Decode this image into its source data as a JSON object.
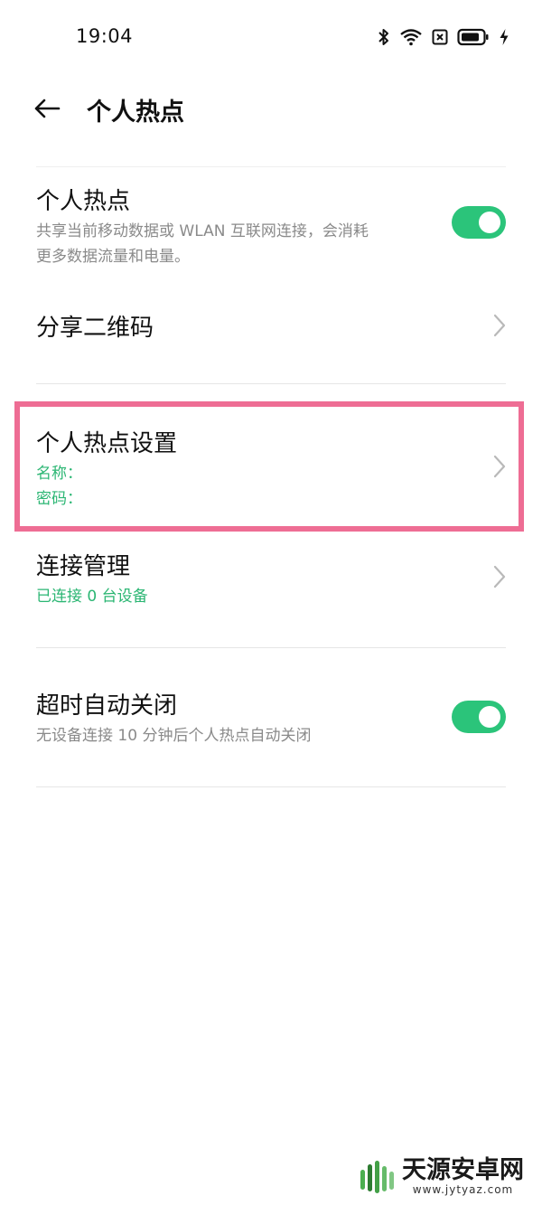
{
  "status_bar": {
    "time": "19:04"
  },
  "header": {
    "title": "个人热点"
  },
  "items": [
    {
      "title": "个人热点",
      "subtitle_line1": "共享当前移动数据或 WLAN 互联网连接，会消耗",
      "subtitle_line2": "更多数据流量和电量。",
      "toggle_on": true
    },
    {
      "title": "分享二维码"
    },
    {
      "title": "个人热点设置",
      "name_label": "名称：",
      "password_label": "密码："
    },
    {
      "title": "连接管理",
      "subtitle": "已连接 0 台设备"
    },
    {
      "title": "超时自动关闭",
      "subtitle": "无设备连接 10 分钟后个人热点自动关闭",
      "toggle_on": true
    }
  ],
  "colors": {
    "accent_green": "#2bc47a",
    "highlight_pink": "#ee6d94"
  },
  "watermark": {
    "name": "天源安卓网",
    "url": "www.jytyaz.com"
  }
}
